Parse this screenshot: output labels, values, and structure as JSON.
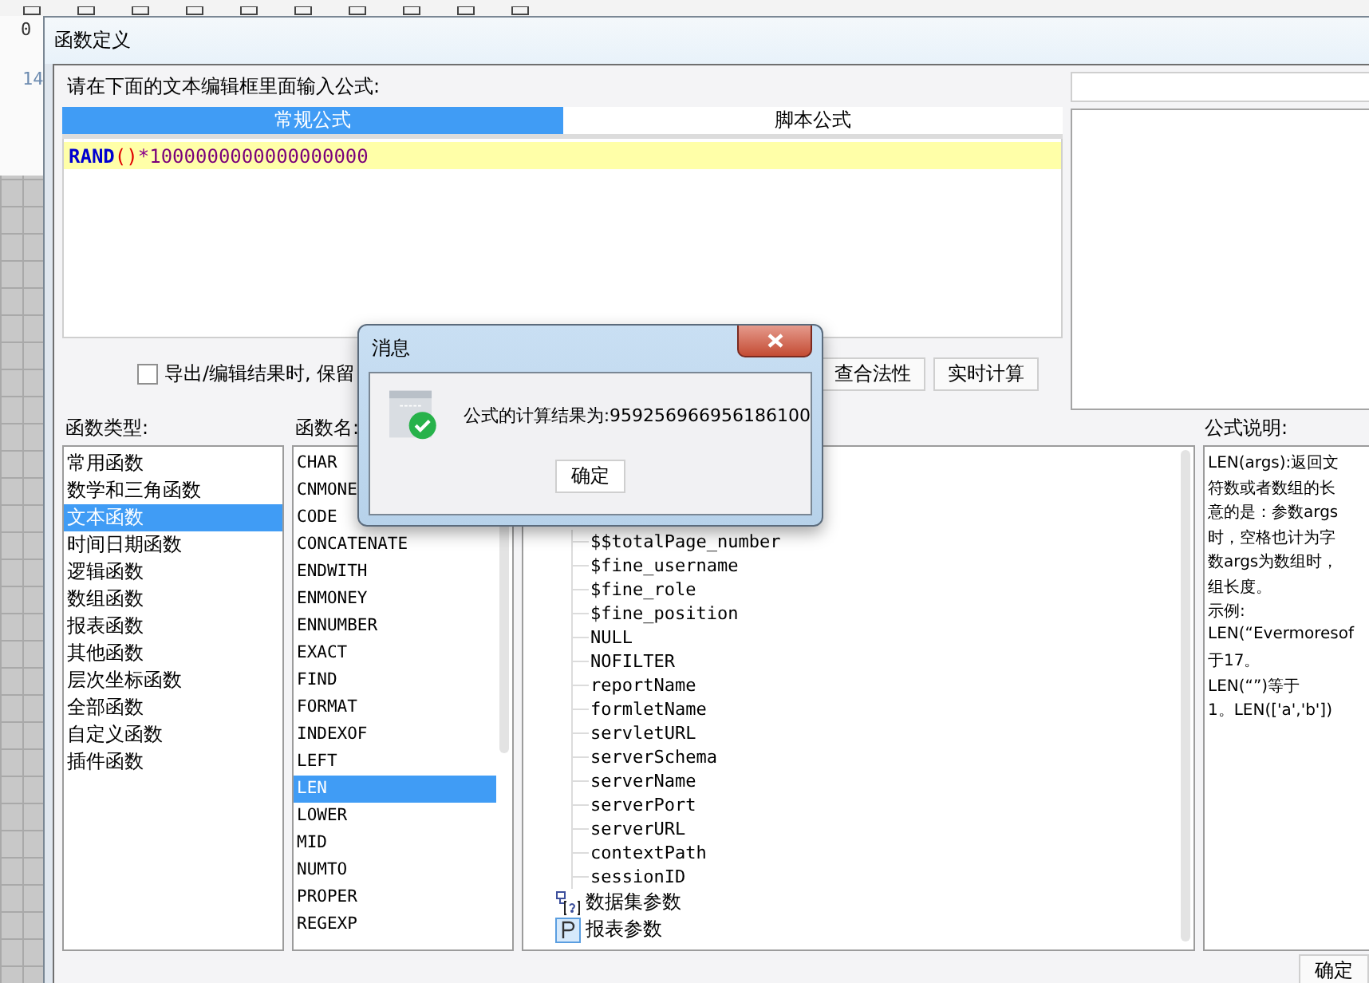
{
  "app_background": {
    "ruler_labels": [
      "0",
      "14"
    ]
  },
  "window": {
    "title": "函数定义"
  },
  "prompt": "请在下面的文本编辑框里面输入公式:",
  "tabs": [
    {
      "label": "常规公式",
      "selected": true
    },
    {
      "label": "脚本公式",
      "selected": false
    }
  ],
  "editor": {
    "tokens": [
      {
        "text": "RAND",
        "kind": "function"
      },
      {
        "text": "(",
        "kind": "paren"
      },
      {
        "text": ")",
        "kind": "paren"
      },
      {
        "text": "*",
        "kind": "operator"
      },
      {
        "text": "1000000000000000000",
        "kind": "number"
      }
    ]
  },
  "keep_format": {
    "label": "导出/编辑结果时, 保留",
    "checked": false
  },
  "buttons": [
    "查合法性",
    "实时计算"
  ],
  "function_types": {
    "label": "函数类型:",
    "items": [
      {
        "label": "常用函数",
        "selected": false
      },
      {
        "label": "数学和三角函数",
        "selected": false
      },
      {
        "label": "文本函数",
        "selected": true
      },
      {
        "label": "时间日期函数",
        "selected": false
      },
      {
        "label": "逻辑函数",
        "selected": false
      },
      {
        "label": "数组函数",
        "selected": false
      },
      {
        "label": "报表函数",
        "selected": false
      },
      {
        "label": "其他函数",
        "selected": false
      },
      {
        "label": "层次坐标函数",
        "selected": false
      },
      {
        "label": "全部函数",
        "selected": false
      },
      {
        "label": "自定义函数",
        "selected": false
      },
      {
        "label": "插件函数",
        "selected": false
      }
    ]
  },
  "function_names": {
    "label": "函数名:",
    "items": [
      {
        "label": "CHAR",
        "selected": false
      },
      {
        "label": "CNMONE",
        "selected": false
      },
      {
        "label": "CODE",
        "selected": false
      },
      {
        "label": "CONCATENATE",
        "selected": false
      },
      {
        "label": "ENDWITH",
        "selected": false
      },
      {
        "label": "ENMONEY",
        "selected": false
      },
      {
        "label": "ENNUMBER",
        "selected": false
      },
      {
        "label": "EXACT",
        "selected": false
      },
      {
        "label": "FIND",
        "selected": false
      },
      {
        "label": "FORMAT",
        "selected": false
      },
      {
        "label": "INDEXOF",
        "selected": false
      },
      {
        "label": "LEFT",
        "selected": false
      },
      {
        "label": "LEN",
        "selected": true
      },
      {
        "label": "LOWER",
        "selected": false
      },
      {
        "label": "MID",
        "selected": false
      },
      {
        "label": "NUMTO",
        "selected": false
      },
      {
        "label": "PROPER",
        "selected": false
      },
      {
        "label": "REGEXP",
        "selected": false
      }
    ]
  },
  "tree": {
    "items": [
      {
        "kind": "group",
        "children": [
          {
            "label": "$$totalPage_number"
          },
          {
            "label": "$fine_username"
          },
          {
            "label": "$fine_role"
          },
          {
            "label": "$fine_position"
          },
          {
            "label": "NULL"
          },
          {
            "label": "NOFILTER"
          },
          {
            "label": "reportName"
          },
          {
            "label": "formletName"
          },
          {
            "label": "servletURL"
          },
          {
            "label": "serverSchema"
          },
          {
            "label": "serverName"
          },
          {
            "label": "serverPort"
          },
          {
            "label": "serverURL"
          },
          {
            "label": "contextPath"
          },
          {
            "label": "sessionID"
          }
        ]
      },
      {
        "kind": "dataset",
        "label": "数据集参数"
      },
      {
        "kind": "report",
        "label": "报表参数"
      }
    ]
  },
  "description": {
    "label": "公式说明:",
    "lines": [
      "LEN(args):返回文",
      "符数或者数组的长",
      "意的是：参数args",
      "时，空格也计为字",
      "数args为数组时，",
      "组长度。",
      "示例:",
      "LEN(“Evermoresof",
      "于17。",
      "LEN(“”)等于",
      "1。LEN(['a','b'])"
    ]
  },
  "ok_button": "确定",
  "message": {
    "title": "消息",
    "text": "公式的计算结果为:959256966956186100",
    "button": "确定"
  }
}
